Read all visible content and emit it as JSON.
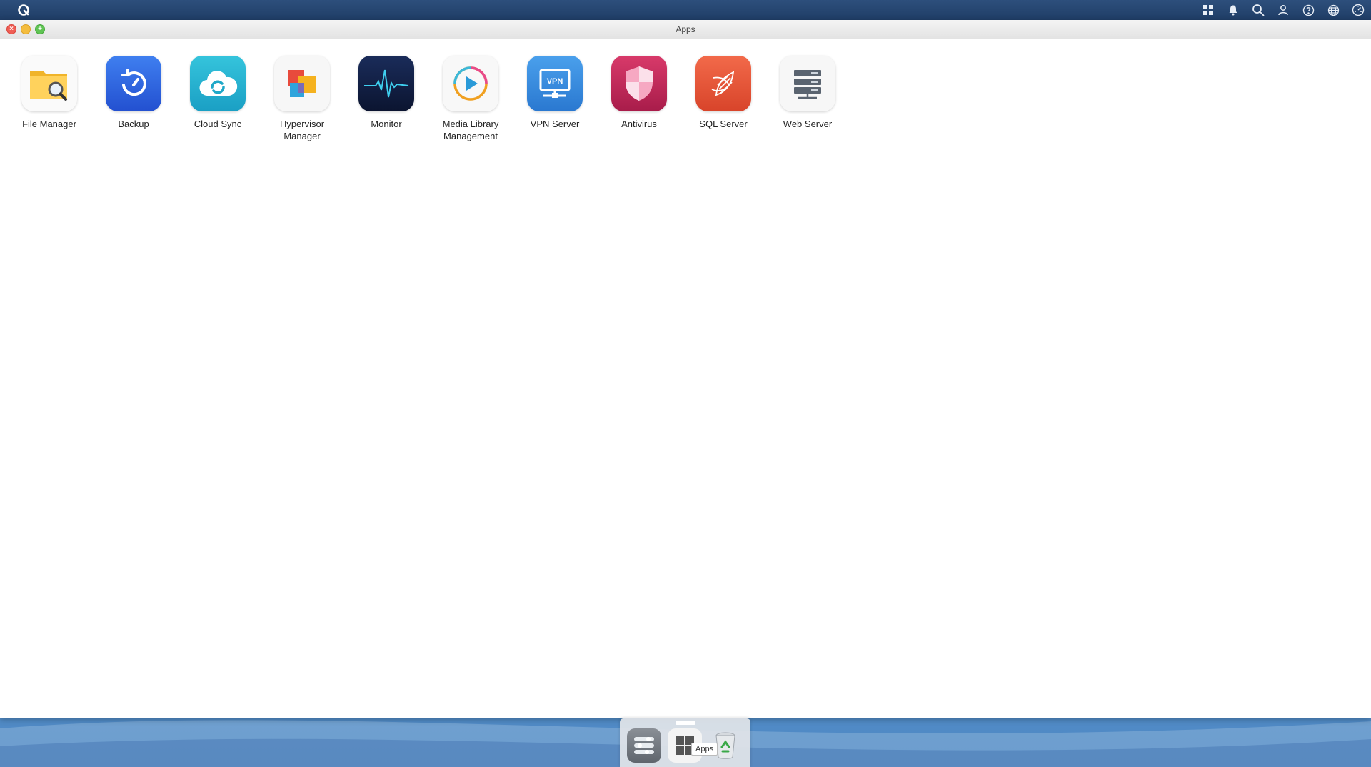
{
  "window": {
    "title": "Apps"
  },
  "apps": [
    {
      "label": "File Manager"
    },
    {
      "label": "Backup"
    },
    {
      "label": "Cloud Sync"
    },
    {
      "label": "Hypervisor Manager"
    },
    {
      "label": "Monitor"
    },
    {
      "label": "Media Library Management"
    },
    {
      "label": "VPN Server",
      "icon_text": "VPN"
    },
    {
      "label": "Antivirus"
    },
    {
      "label": "SQL Server"
    },
    {
      "label": "Web Server"
    }
  ],
  "dock": {
    "tooltip": "Apps"
  },
  "topbar_icons": [
    "apps-grid-icon",
    "bell-icon",
    "search-icon",
    "user-icon",
    "help-icon",
    "globe-icon",
    "dashboard-icon"
  ],
  "colors": {
    "topbar": "#1f3d66",
    "close": "#ef5e55",
    "minimize": "#f4bd3f",
    "maximize": "#60c454"
  }
}
